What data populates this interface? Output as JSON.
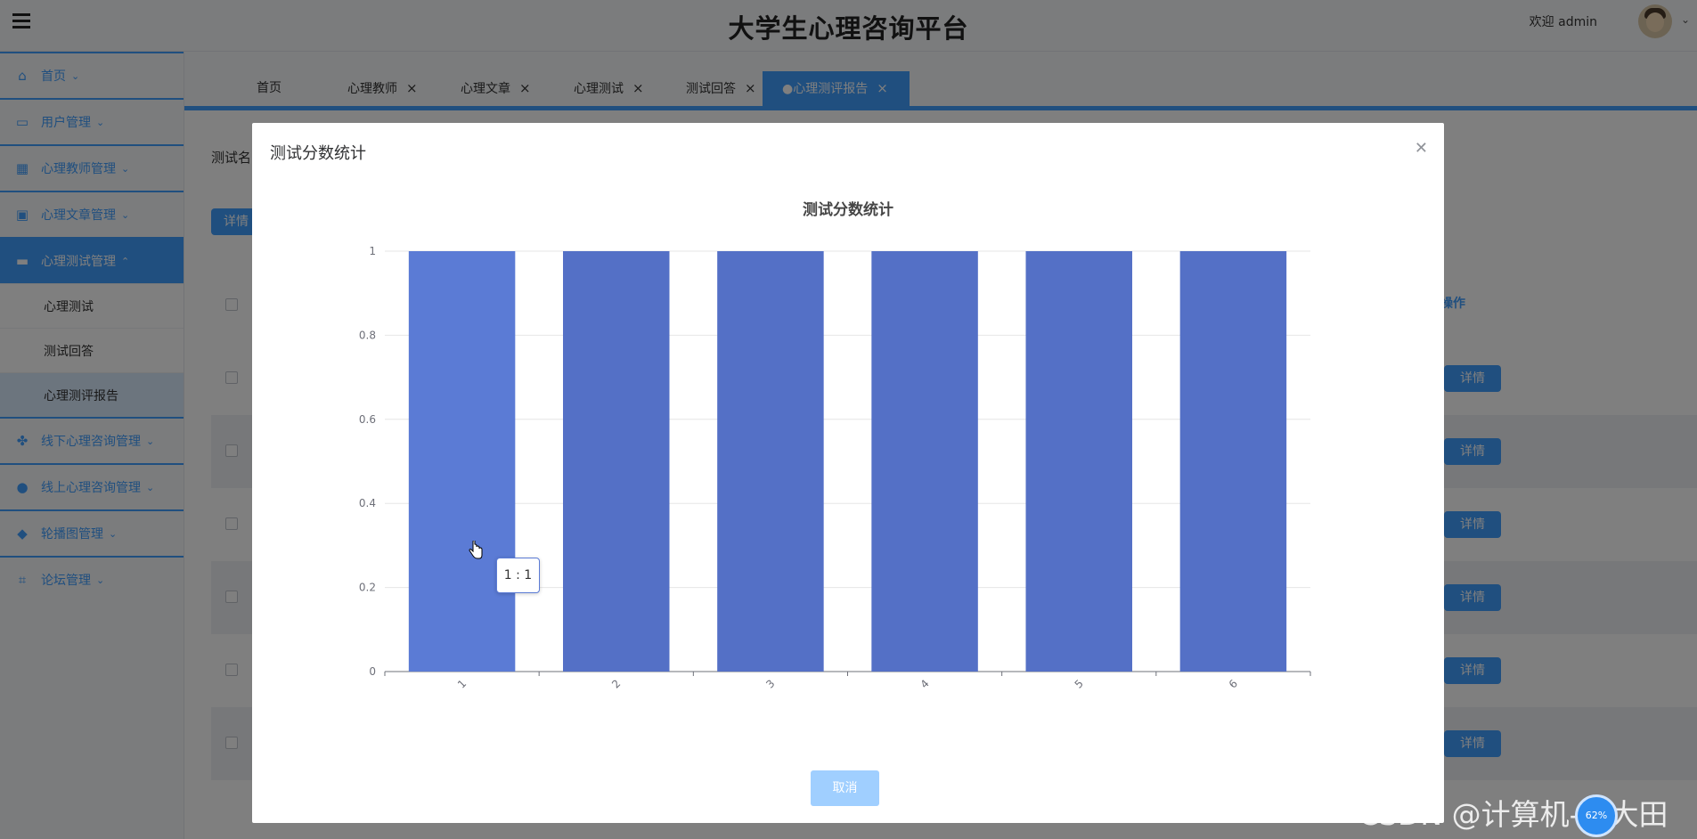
{
  "header": {
    "title": "大学生心理咨询平台",
    "welcome": "欢迎 admin"
  },
  "sidebar": {
    "items": [
      {
        "label": "首页",
        "icon": "home-icon"
      },
      {
        "label": "用户管理",
        "icon": "wallet-icon"
      },
      {
        "label": "心理教师管理",
        "icon": "grid-icon"
      },
      {
        "label": "心理文章管理",
        "icon": "briefcase-icon"
      },
      {
        "label": "心理测试管理",
        "icon": "book-icon",
        "active": true
      },
      {
        "label": "线下心理咨询管理",
        "icon": "apps-icon"
      },
      {
        "label": "线上心理咨询管理",
        "icon": "chat-dots-icon"
      },
      {
        "label": "轮播图管理",
        "icon": "drop-icon"
      },
      {
        "label": "论坛管理",
        "icon": "crop-icon"
      }
    ],
    "subitems": [
      {
        "label": "心理测试"
      },
      {
        "label": "测试回答"
      },
      {
        "label": "心理测评报告",
        "active": true
      }
    ]
  },
  "tabs": [
    {
      "label": "首页",
      "closable": false
    },
    {
      "label": "心理教师",
      "closable": true
    },
    {
      "label": "心理文章",
      "closable": true
    },
    {
      "label": "心理测试",
      "closable": true
    },
    {
      "label": "测试回答",
      "closable": true
    },
    {
      "label": "●心理测评报告",
      "closable": true,
      "active": true
    }
  ],
  "content": {
    "filter_label": "测试名",
    "top_button": "详情",
    "op_header": "操作",
    "row_button": "详情"
  },
  "modal": {
    "title": "测试分数统计",
    "cancel": "取消",
    "tooltip": "1 : 1"
  },
  "chart_data": {
    "type": "bar",
    "title": "测试分数统计",
    "categories": [
      "1",
      "2",
      "3",
      "4",
      "5",
      "6"
    ],
    "values": [
      1,
      1,
      1,
      1,
      1,
      1
    ],
    "ylim": [
      0,
      1
    ],
    "yticks": [
      "0",
      "0.2",
      "0.4",
      "0.6",
      "0.8",
      "1"
    ],
    "xlabel": "",
    "ylabel": "",
    "grid": true,
    "colors": {
      "bar": "#5470c6",
      "bar_hover": "#5b7bd5"
    }
  },
  "watermark": "CSDN @计算机-秋大田",
  "badge": "62%"
}
